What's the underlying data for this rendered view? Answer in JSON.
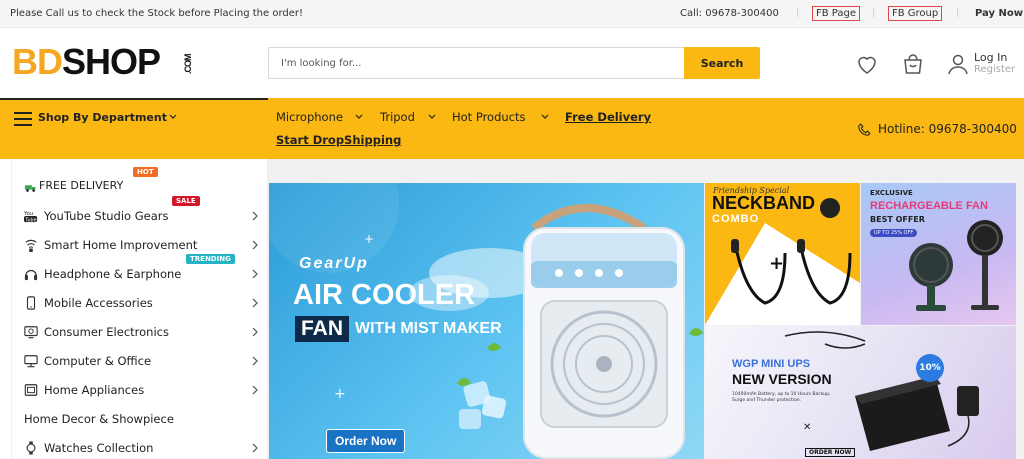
{
  "topbar": {
    "notice": "Please Call us to check the Stock before Placing the order!",
    "call": "Call: 09678-300400",
    "fb_page": "FB Page",
    "fb_group": "FB Group",
    "pay_now": "Pay Now"
  },
  "header": {
    "logo_bd": "BD",
    "logo_shop": "SHOP",
    "logo_com": ".COM",
    "search_placeholder": "I'm looking for...",
    "search_label": "Search",
    "login": "Log In",
    "register": "Register"
  },
  "nav": {
    "department": "Shop By Department",
    "links": [
      "Microphone",
      "Tripod",
      "Hot Products",
      "Free Delivery",
      "Start DropShipping"
    ],
    "hotline": "Hotline: 09678-300400"
  },
  "sidebar": {
    "items": [
      {
        "label": "FREE DELIVERY",
        "icon": "truck-icon",
        "tag": "HOT"
      },
      {
        "label": "YouTube Studio Gears",
        "icon": "youtube-icon",
        "tag": "SALE"
      },
      {
        "label": "Smart Home Improvement",
        "icon": "wifi-icon"
      },
      {
        "label": "Headphone & Earphone",
        "icon": "headphone-icon",
        "tag": "TRENDING"
      },
      {
        "label": "Mobile Accessories",
        "icon": "mobile-icon"
      },
      {
        "label": "Consumer Electronics",
        "icon": "tv-icon"
      },
      {
        "label": "Computer & Office",
        "icon": "computer-icon"
      },
      {
        "label": "Home Appliances",
        "icon": "appliance-icon"
      },
      {
        "label": "Home Decor & Showpiece",
        "icon": ""
      },
      {
        "label": "Watches Collection",
        "icon": "watch-icon"
      }
    ]
  },
  "banners": {
    "main": {
      "gear_up": "GearUp",
      "air_cooler": "AIR COOLER",
      "fan": "FAN",
      "mist": "WITH MIST MAKER",
      "order_now": "Order Now"
    },
    "neckband": {
      "special": "Friendship Special",
      "title": "NECKBAND",
      "combo": "COMBO"
    },
    "fan": {
      "exclusive": "EXCLUSIVE",
      "title": "RECHARGEABLE FAN",
      "best_offer": "BEST OFFER",
      "off": "UP TO 25% OFF"
    },
    "ups": {
      "brand": "WGP MINI UPS",
      "title": "NEW VERSION",
      "desc": "10400mAh Battery, up to 10 Hours Backup, Surge and Thunder protection.",
      "badge": "10%",
      "order": "ORDER NOW"
    }
  },
  "colors": {
    "accent": "#fbb812",
    "hot": "#f26c24",
    "sale": "#d3182b",
    "trending": "#24b3c3"
  }
}
